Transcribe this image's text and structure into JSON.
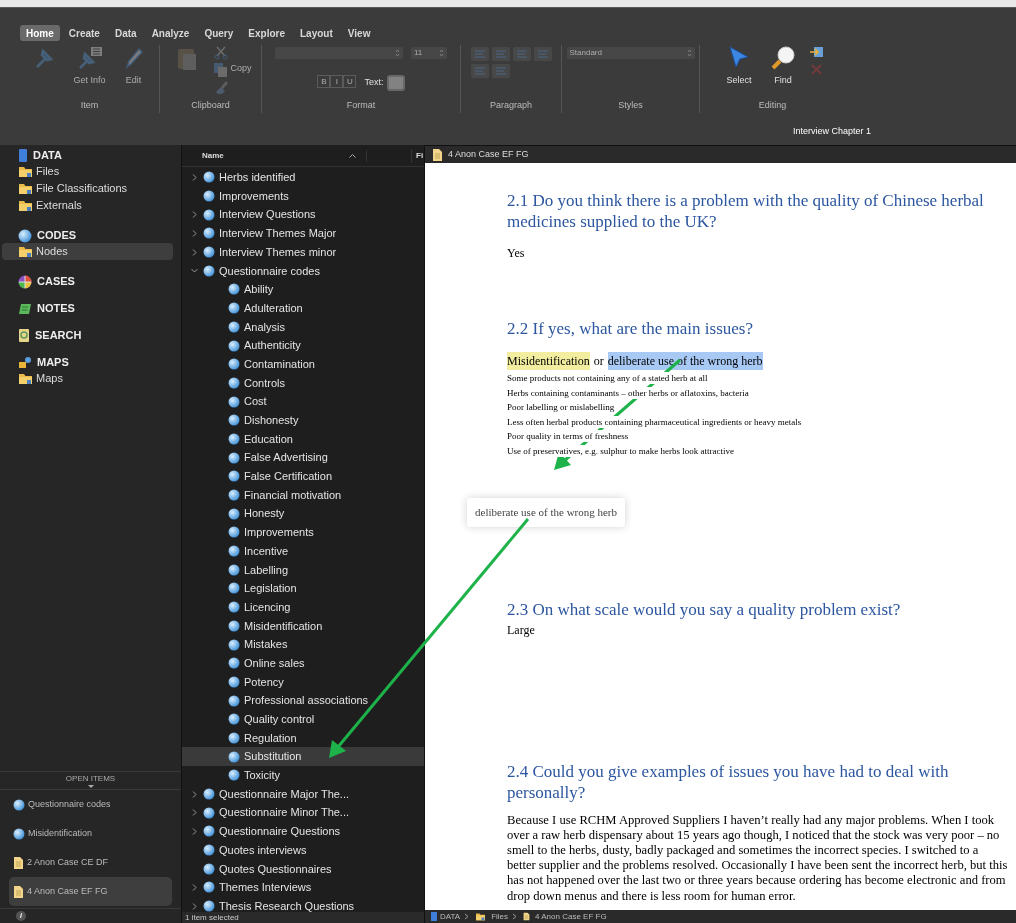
{
  "ribbon": {
    "tabs": [
      {
        "label": "Home",
        "selected": true
      },
      {
        "label": "Create",
        "selected": false
      },
      {
        "label": "Data",
        "selected": false
      },
      {
        "label": "Analyze",
        "selected": false
      },
      {
        "label": "Query",
        "selected": false
      },
      {
        "label": "Explore",
        "selected": false
      },
      {
        "label": "Layout",
        "selected": false
      },
      {
        "label": "View",
        "selected": false
      }
    ],
    "groups": [
      {
        "label": "Item",
        "controls": [
          {
            "kind": "tool",
            "disabled": true
          },
          {
            "kind": "tool",
            "label": "Get Info",
            "disabled": true
          },
          {
            "kind": "tool",
            "label": "Edit",
            "disabled": true
          }
        ]
      },
      {
        "label": "Clipboard",
        "controls": [
          {
            "kind": "tool",
            "disabled": true
          },
          {
            "kind": "small",
            "disabled": true
          },
          {
            "kind": "small",
            "label": "Copy",
            "disabled": true
          },
          {
            "kind": "small",
            "disabled": true
          }
        ]
      },
      {
        "label": "Format",
        "controls": [
          {
            "kind": "select",
            "disabled": true
          },
          {
            "kind": "select",
            "value": "11",
            "disabled": true
          },
          {
            "kind": "styles",
            "letters": [
              "B",
              "I",
              "U"
            ],
            "disabled": true
          },
          {
            "kind": "swatch",
            "label": "Text:",
            "disabled": true
          }
        ]
      },
      {
        "label": "Paragraph",
        "controls": [
          {
            "kind": "align-set",
            "disabled": true
          }
        ]
      },
      {
        "label": "Styles",
        "controls": [
          {
            "kind": "select",
            "value": "Standard",
            "disabled": true
          }
        ]
      },
      {
        "label": "Editing",
        "controls": [
          {
            "kind": "tool",
            "label": "Select",
            "disabled": false
          },
          {
            "kind": "tool",
            "label": "Find",
            "disabled": false
          },
          {
            "kind": "small",
            "disabled": false
          },
          {
            "kind": "small",
            "disabled": true
          }
        ]
      }
    ],
    "document_title": "Interview Chapter 1"
  },
  "sidebar": {
    "sections": [
      {
        "heading": "DATA",
        "kind": "data",
        "items": [
          {
            "label": "Files",
            "selected": false
          },
          {
            "label": "File Classifications",
            "selected": false
          },
          {
            "label": "Externals",
            "selected": false
          }
        ]
      },
      {
        "heading": "CODES",
        "kind": "codes",
        "items": [
          {
            "label": "Nodes",
            "selected": true
          }
        ]
      },
      {
        "heading": "CASES",
        "kind": "cases"
      },
      {
        "heading": "NOTES",
        "kind": "notes"
      },
      {
        "heading": "SEARCH",
        "kind": "search"
      },
      {
        "heading": "MAPS",
        "kind": "maps",
        "items": [
          {
            "label": "Maps",
            "selected": false
          }
        ]
      }
    ],
    "open_items": {
      "title": "OPEN ITEMS",
      "items": [
        {
          "label": "Questionnaire codes",
          "kind": "node",
          "selected": false
        },
        {
          "label": "Misidentification",
          "kind": "node",
          "selected": false
        },
        {
          "label": "2 Anon Case CE DF",
          "kind": "file",
          "selected": false
        },
        {
          "label": "4 Anon Case EF FG",
          "kind": "file",
          "selected": true
        }
      ]
    },
    "info_button": "i"
  },
  "tree": {
    "columns": [
      "Name",
      "Fi"
    ],
    "rows": [
      {
        "label": "Herbs identified",
        "expanded": false,
        "selected": false
      },
      {
        "label": "Improvements",
        "selected": false
      },
      {
        "label": "Interview Questions",
        "expanded": false,
        "selected": false
      },
      {
        "label": "Interview Themes Major",
        "expanded": false,
        "selected": false
      },
      {
        "label": "Interview Themes minor",
        "expanded": false,
        "selected": false
      },
      {
        "label": "Questionnaire codes",
        "expanded": true,
        "selected": false,
        "children": [
          {
            "label": "Ability",
            "selected": false
          },
          {
            "label": "Adulteration",
            "selected": false
          },
          {
            "label": "Analysis",
            "selected": false
          },
          {
            "label": "Authenticity",
            "selected": false
          },
          {
            "label": "Contamination",
            "selected": false
          },
          {
            "label": "Controls",
            "selected": false
          },
          {
            "label": "Cost",
            "selected": false
          },
          {
            "label": "Dishonesty",
            "selected": false
          },
          {
            "label": "Education",
            "selected": false
          },
          {
            "label": "False Advertising",
            "selected": false
          },
          {
            "label": "False Certification",
            "selected": false
          },
          {
            "label": "Financial motivation",
            "selected": false
          },
          {
            "label": "Honesty",
            "selected": false
          },
          {
            "label": "Improvements",
            "selected": false
          },
          {
            "label": "Incentive",
            "selected": false
          },
          {
            "label": "Labelling",
            "selected": false
          },
          {
            "label": "Legislation",
            "selected": false
          },
          {
            "label": "Licencing",
            "selected": false
          },
          {
            "label": "Misidentification",
            "selected": false
          },
          {
            "label": "Mistakes",
            "selected": false
          },
          {
            "label": "Online sales",
            "selected": false
          },
          {
            "label": "Potency",
            "selected": false
          },
          {
            "label": "Professional associations",
            "selected": false
          },
          {
            "label": "Quality control",
            "selected": false
          },
          {
            "label": "Regulation",
            "selected": false
          },
          {
            "label": "Substitution",
            "selected": true
          },
          {
            "label": "Toxicity",
            "selected": false
          }
        ]
      },
      {
        "label": "Questionnaire Major The...",
        "expanded": false,
        "selected": false
      },
      {
        "label": "Questionnaire Minor The...",
        "expanded": false,
        "selected": false
      },
      {
        "label": "Questionnaire Questions",
        "expanded": false,
        "selected": false
      },
      {
        "label": "Quotes interviews",
        "selected": false
      },
      {
        "label": "Quotes Questionnaires",
        "selected": false
      },
      {
        "label": "Themes Interviews",
        "expanded": false,
        "selected": false
      },
      {
        "label": "Thesis Research Questions",
        "expanded": false,
        "selected": false
      }
    ],
    "status": "1 item selected"
  },
  "document": {
    "tab": "4 Anon Case EF FG",
    "blocks": [
      {
        "kind": "heading",
        "text": "2.1 Do you think there is a problem with the quality of Chinese herbal medicines supplied to the UK?"
      },
      {
        "kind": "answer",
        "text": "Yes"
      },
      {
        "kind": "heading",
        "text": "2.2 If yes, what are the main issues?"
      },
      {
        "kind": "coded-line",
        "parts": [
          {
            "text": "Misidentification",
            "coded": true,
            "selected": false
          },
          {
            "text": "or",
            "coded": false,
            "selected": false
          },
          {
            "text": "deliberate use of the wrong herb",
            "coded": false,
            "selected": true
          }
        ]
      },
      {
        "kind": "list",
        "lines": [
          "Some products not containing any of a stated herb at all",
          "Herbs containing contaminants – other herbs or aflatoxins, bacteria",
          "Poor labelling or mislabelling",
          "Less often herbal products containing pharmaceutical ingredients or heavy metals",
          "Poor quality in terms of freshness",
          "Use of preservatives, e.g. sulphur to make herbs look attractive"
        ]
      },
      {
        "kind": "drag-label",
        "text": "deliberate use of the wrong herb"
      },
      {
        "kind": "heading",
        "text": "2.3 On what scale would you say a quality problem exist?"
      },
      {
        "kind": "answer",
        "text": "Large"
      },
      {
        "kind": "heading",
        "text": "2.4 Could you give examples of issues you have had to deal with personally?"
      },
      {
        "kind": "paragraph",
        "text": "Because I use RCHM Approved Suppliers I haven’t really had any major problems.  When I took over a raw herb dispensary about 15 years ago though, I noticed that the stock was very poor – no smell to the herbs, dusty, badly packaged and sometimes the incorrect species.  I switched to a better supplier and the problems resolved.  Occasionally I have been sent the incorrect herb, but this has not happened over the last two or three years because ordering has become electronic and from drop down menus and there is less room for human error."
      }
    ],
    "breadcrumb": [
      {
        "label": "DATA",
        "kind": "data"
      },
      {
        "label": "Files",
        "kind": "folder"
      },
      {
        "label": "4 Anon Case EF FG",
        "kind": "file"
      }
    ]
  }
}
